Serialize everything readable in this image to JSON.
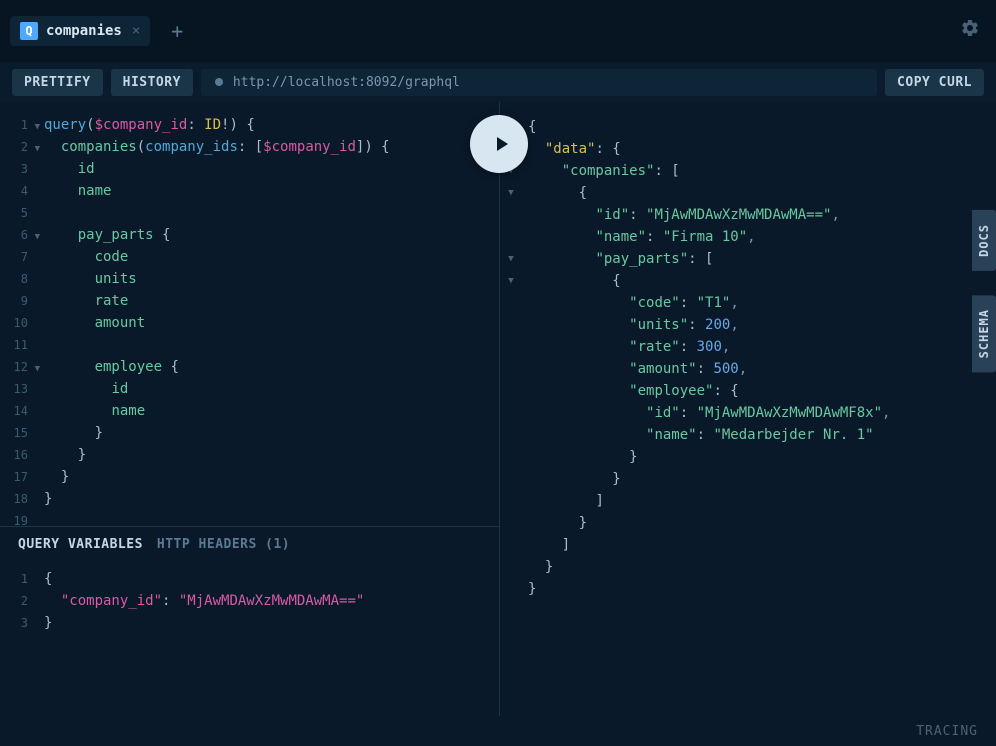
{
  "tab": {
    "badge": "Q",
    "title": "companies"
  },
  "toolbar": {
    "prettify": "PRETTIFY",
    "history": "HISTORY",
    "endpoint": "http://localhost:8092/graphql",
    "copycurl": "COPY CURL"
  },
  "query_lines": [
    [
      {
        "t": "kw",
        "v": "query"
      },
      {
        "t": "paren",
        "v": "("
      },
      {
        "t": "var",
        "v": "$company_id"
      },
      {
        "t": "paren",
        "v": ": "
      },
      {
        "t": "type",
        "v": "ID"
      },
      {
        "t": "paren",
        "v": "!) {"
      }
    ],
    [
      {
        "t": "paren",
        "v": "  "
      },
      {
        "t": "field",
        "v": "companies"
      },
      {
        "t": "paren",
        "v": "("
      },
      {
        "t": "kw",
        "v": "company_ids"
      },
      {
        "t": "paren",
        "v": ": ["
      },
      {
        "t": "var",
        "v": "$company_id"
      },
      {
        "t": "paren",
        "v": "]) {"
      }
    ],
    [
      {
        "t": "paren",
        "v": "    "
      },
      {
        "t": "field",
        "v": "id"
      }
    ],
    [
      {
        "t": "paren",
        "v": "    "
      },
      {
        "t": "field",
        "v": "name"
      }
    ],
    [
      {
        "t": "paren",
        "v": ""
      }
    ],
    [
      {
        "t": "paren",
        "v": "    "
      },
      {
        "t": "field",
        "v": "pay_parts"
      },
      {
        "t": "paren",
        "v": " {"
      }
    ],
    [
      {
        "t": "paren",
        "v": "      "
      },
      {
        "t": "field",
        "v": "code"
      }
    ],
    [
      {
        "t": "paren",
        "v": "      "
      },
      {
        "t": "field",
        "v": "units"
      }
    ],
    [
      {
        "t": "paren",
        "v": "      "
      },
      {
        "t": "field",
        "v": "rate"
      }
    ],
    [
      {
        "t": "paren",
        "v": "      "
      },
      {
        "t": "field",
        "v": "amount"
      }
    ],
    [
      {
        "t": "paren",
        "v": ""
      }
    ],
    [
      {
        "t": "paren",
        "v": "      "
      },
      {
        "t": "field",
        "v": "employee"
      },
      {
        "t": "paren",
        "v": " {"
      }
    ],
    [
      {
        "t": "paren",
        "v": "        "
      },
      {
        "t": "field",
        "v": "id"
      }
    ],
    [
      {
        "t": "paren",
        "v": "        "
      },
      {
        "t": "field",
        "v": "name"
      }
    ],
    [
      {
        "t": "paren",
        "v": "      }"
      }
    ],
    [
      {
        "t": "paren",
        "v": "    }"
      }
    ],
    [
      {
        "t": "paren",
        "v": "  }"
      }
    ],
    [
      {
        "t": "paren",
        "v": "}"
      }
    ],
    [
      {
        "t": "paren",
        "v": ""
      }
    ]
  ],
  "query_fold_rows": [
    1,
    2,
    6,
    12
  ],
  "var_tabs": {
    "active": "QUERY VARIABLES",
    "inactive": "HTTP HEADERS (1)"
  },
  "var_lines": [
    [
      {
        "t": "paren",
        "v": "{"
      }
    ],
    [
      {
        "t": "paren",
        "v": "  "
      },
      {
        "t": "var",
        "v": "\"company_id\""
      },
      {
        "t": "paren",
        "v": ": "
      },
      {
        "t": "var",
        "v": "\"MjAwMDAwXzMwMDAwMA==\""
      }
    ],
    [
      {
        "t": "paren",
        "v": "}"
      }
    ]
  ],
  "result_lines": [
    {
      "fold": true,
      "indent": 0,
      "tokens": [
        {
          "t": "paren",
          "v": "{"
        }
      ]
    },
    {
      "fold": true,
      "indent": 1,
      "tokens": [
        {
          "t": "yellow",
          "v": "\"data\""
        },
        {
          "t": "paren",
          "v": ": {"
        }
      ]
    },
    {
      "fold": true,
      "indent": 2,
      "tokens": [
        {
          "t": "key",
          "v": "\"companies\""
        },
        {
          "t": "paren",
          "v": ": ["
        }
      ]
    },
    {
      "fold": true,
      "indent": 3,
      "tokens": [
        {
          "t": "paren",
          "v": "{"
        }
      ]
    },
    {
      "fold": false,
      "indent": 4,
      "tokens": [
        {
          "t": "key",
          "v": "\"id\""
        },
        {
          "t": "paren",
          "v": ": "
        },
        {
          "t": "str",
          "v": "\"MjAwMDAwXzMwMDAwMA==\""
        },
        {
          "t": "comma",
          "v": ","
        }
      ]
    },
    {
      "fold": false,
      "indent": 4,
      "tokens": [
        {
          "t": "key",
          "v": "\"name\""
        },
        {
          "t": "paren",
          "v": ": "
        },
        {
          "t": "str",
          "v": "\"Firma 10\""
        },
        {
          "t": "comma",
          "v": ","
        }
      ]
    },
    {
      "fold": true,
      "indent": 4,
      "tokens": [
        {
          "t": "key",
          "v": "\"pay_parts\""
        },
        {
          "t": "paren",
          "v": ": ["
        }
      ]
    },
    {
      "fold": true,
      "indent": 5,
      "tokens": [
        {
          "t": "paren",
          "v": "{"
        }
      ]
    },
    {
      "fold": false,
      "indent": 6,
      "tokens": [
        {
          "t": "key",
          "v": "\"code\""
        },
        {
          "t": "paren",
          "v": ": "
        },
        {
          "t": "str",
          "v": "\"T1\""
        },
        {
          "t": "comma",
          "v": ","
        }
      ]
    },
    {
      "fold": false,
      "indent": 6,
      "tokens": [
        {
          "t": "key",
          "v": "\"units\""
        },
        {
          "t": "paren",
          "v": ": "
        },
        {
          "t": "num",
          "v": "200"
        },
        {
          "t": "comma",
          "v": ","
        }
      ]
    },
    {
      "fold": false,
      "indent": 6,
      "tokens": [
        {
          "t": "key",
          "v": "\"rate\""
        },
        {
          "t": "paren",
          "v": ": "
        },
        {
          "t": "num",
          "v": "300"
        },
        {
          "t": "comma",
          "v": ","
        }
      ]
    },
    {
      "fold": false,
      "indent": 6,
      "tokens": [
        {
          "t": "key",
          "v": "\"amount\""
        },
        {
          "t": "paren",
          "v": ": "
        },
        {
          "t": "num",
          "v": "500"
        },
        {
          "t": "comma",
          "v": ","
        }
      ]
    },
    {
      "fold": false,
      "indent": 6,
      "tokens": [
        {
          "t": "key",
          "v": "\"employee\""
        },
        {
          "t": "paren",
          "v": ": {"
        }
      ]
    },
    {
      "fold": false,
      "indent": 7,
      "tokens": [
        {
          "t": "key",
          "v": "\"id\""
        },
        {
          "t": "paren",
          "v": ": "
        },
        {
          "t": "str",
          "v": "\"MjAwMDAwXzMwMDAwMF8x\""
        },
        {
          "t": "comma",
          "v": ","
        }
      ]
    },
    {
      "fold": false,
      "indent": 7,
      "tokens": [
        {
          "t": "key",
          "v": "\"name\""
        },
        {
          "t": "paren",
          "v": ": "
        },
        {
          "t": "str",
          "v": "\"Medarbejder Nr. 1\""
        }
      ]
    },
    {
      "fold": false,
      "indent": 6,
      "tokens": [
        {
          "t": "paren",
          "v": "}"
        }
      ]
    },
    {
      "fold": false,
      "indent": 5,
      "tokens": [
        {
          "t": "paren",
          "v": "}"
        }
      ]
    },
    {
      "fold": false,
      "indent": 4,
      "tokens": [
        {
          "t": "paren",
          "v": "]"
        }
      ]
    },
    {
      "fold": false,
      "indent": 3,
      "tokens": [
        {
          "t": "paren",
          "v": "}"
        }
      ]
    },
    {
      "fold": false,
      "indent": 2,
      "tokens": [
        {
          "t": "paren",
          "v": "]"
        }
      ]
    },
    {
      "fold": false,
      "indent": 1,
      "tokens": [
        {
          "t": "paren",
          "v": "}"
        }
      ]
    },
    {
      "fold": false,
      "indent": 0,
      "tokens": [
        {
          "t": "paren",
          "v": "}"
        }
      ]
    }
  ],
  "side": {
    "docs": "DOCS",
    "schema": "SCHEMA"
  },
  "footer": {
    "tracing": "TRACING"
  }
}
